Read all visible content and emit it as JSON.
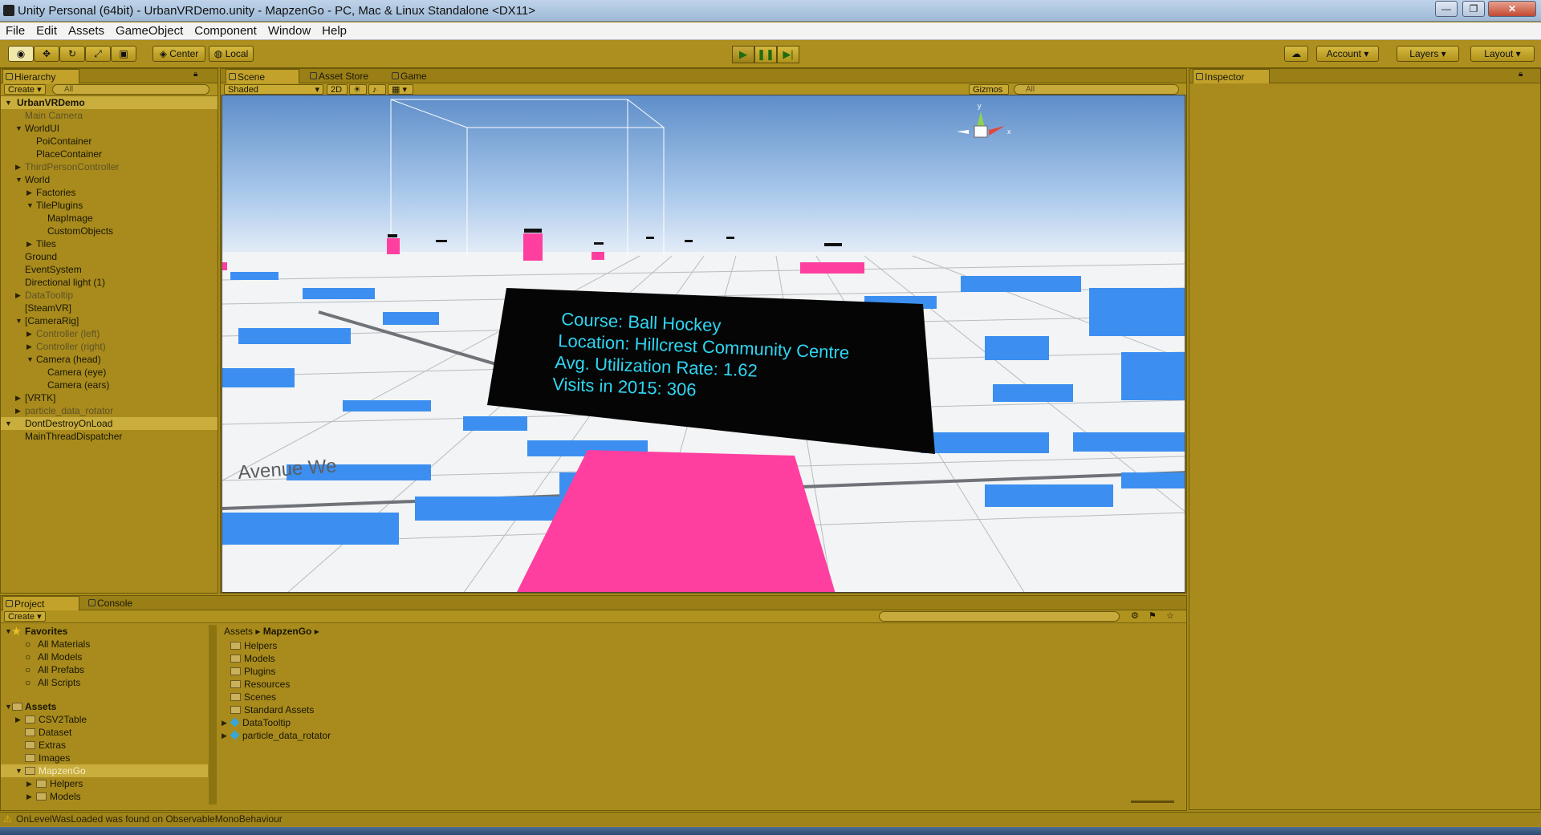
{
  "window": {
    "title": "Unity Personal (64bit) - UrbanVRDemo.unity - MapzenGo - PC, Mac & Linux Standalone <DX11>",
    "min": "—",
    "max": "❐",
    "close": "✕"
  },
  "menu": [
    "File",
    "Edit",
    "Assets",
    "GameObject",
    "Component",
    "Window",
    "Help"
  ],
  "toolbar": {
    "center": "Center",
    "local": "Local",
    "account": "Account",
    "layers": "Layers",
    "layout": "Layout"
  },
  "hierarchy": {
    "tab": "Hierarchy",
    "create": "Create",
    "search": "All",
    "items": [
      "UrbanVRDemo",
      "Main Camera",
      "WorldUI",
      "PoiContainer",
      "PlaceContainer",
      "ThirdPersonController",
      "World",
      "Factories",
      "TilePlugins",
      "MapImage",
      "CustomObjects",
      "Tiles",
      "Ground",
      "EventSystem",
      "Directional light (1)",
      "DataTooltip",
      "[SteamVR]",
      "[CameraRig]",
      "Controller (left)",
      "Controller (right)",
      "Camera (head)",
      "Camera (eye)",
      "Camera (ears)",
      "[VRTK]",
      "particle_data_rotator",
      "DontDestroyOnLoad",
      "MainThreadDispatcher"
    ]
  },
  "scene": {
    "tabs": [
      "Scene",
      "Asset Store",
      "Game"
    ],
    "shading": "Shaded",
    "mode2d": "2D",
    "gizmos": "Gizmos",
    "search": "All",
    "axes": {
      "y": "y",
      "x": "x"
    },
    "tooltip": {
      "line1": "Course: Ball Hockey",
      "line2": "Location: Hillcrest Community Centre",
      "line3": "Avg. Utilization Rate: 1.62",
      "line4": "Visits in 2015: 306"
    },
    "street": "Avenue We",
    "colors": {
      "building": "#3c8ff0",
      "marker": "#ff3fa0",
      "tooltip_text": "#2fd6f2"
    }
  },
  "inspector": {
    "tab": "Inspector"
  },
  "project": {
    "tabs": [
      "Project",
      "Console"
    ],
    "create": "Create",
    "favorites": [
      "Favorites",
      "All Materials",
      "All Models",
      "All Prefabs",
      "All Scripts"
    ],
    "assets": [
      "Assets",
      "CSV2Table",
      "Dataset",
      "Extras",
      "Images",
      "MapzenGo",
      "Helpers",
      "Models",
      "Plugins"
    ],
    "breadcrumb": [
      "Assets",
      "MapzenGo"
    ],
    "contents": [
      "Helpers",
      "Models",
      "Plugins",
      "Resources",
      "Scenes",
      "Standard Assets",
      "DataTooltip",
      "particle_data_rotator"
    ]
  },
  "status": "OnLevelWasLoaded was found on ObservableMonoBehaviour"
}
